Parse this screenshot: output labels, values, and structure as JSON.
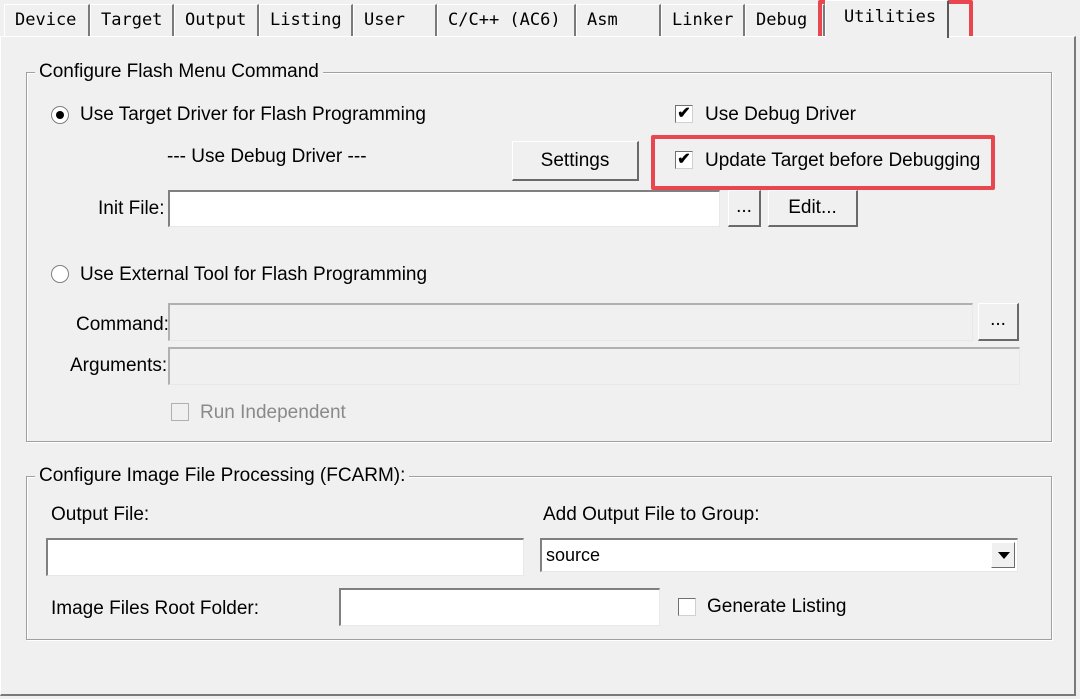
{
  "tabs": [
    {
      "label": "Device"
    },
    {
      "label": "Target"
    },
    {
      "label": "Output"
    },
    {
      "label": "Listing"
    },
    {
      "label": "User"
    },
    {
      "label": "C/C++ (AC6)"
    },
    {
      "label": "Asm"
    },
    {
      "label": "Linker"
    },
    {
      "label": "Debug"
    },
    {
      "label": "Utilities",
      "active": true
    }
  ],
  "flash": {
    "title": "Configure Flash Menu Command",
    "use_target_driver": "Use Target Driver for Flash Programming",
    "use_debug_driver_text": "--- Use Debug Driver ---",
    "settings": "Settings",
    "use_debug_driver_cb": "Use Debug Driver",
    "update_target": "Update Target before Debugging",
    "init_file_label": "Init File:",
    "init_file_value": "",
    "browse": "...",
    "edit": "Edit...",
    "use_external_tool": "Use External Tool for Flash Programming",
    "command_label": "Command:",
    "arguments_label": "Arguments:",
    "run_independent": "Run Independent"
  },
  "image": {
    "title": "Configure Image File Processing (FCARM):",
    "output_file_label": "Output File:",
    "output_file_value": "",
    "add_to_group_label": "Add Output File  to Group:",
    "group_value": "source",
    "root_folder_label": "Image Files Root Folder:",
    "root_folder_value": "",
    "generate_listing": "Generate Listing"
  },
  "colors": {
    "highlight": "#e8474f",
    "background": "#f0f0f0"
  }
}
